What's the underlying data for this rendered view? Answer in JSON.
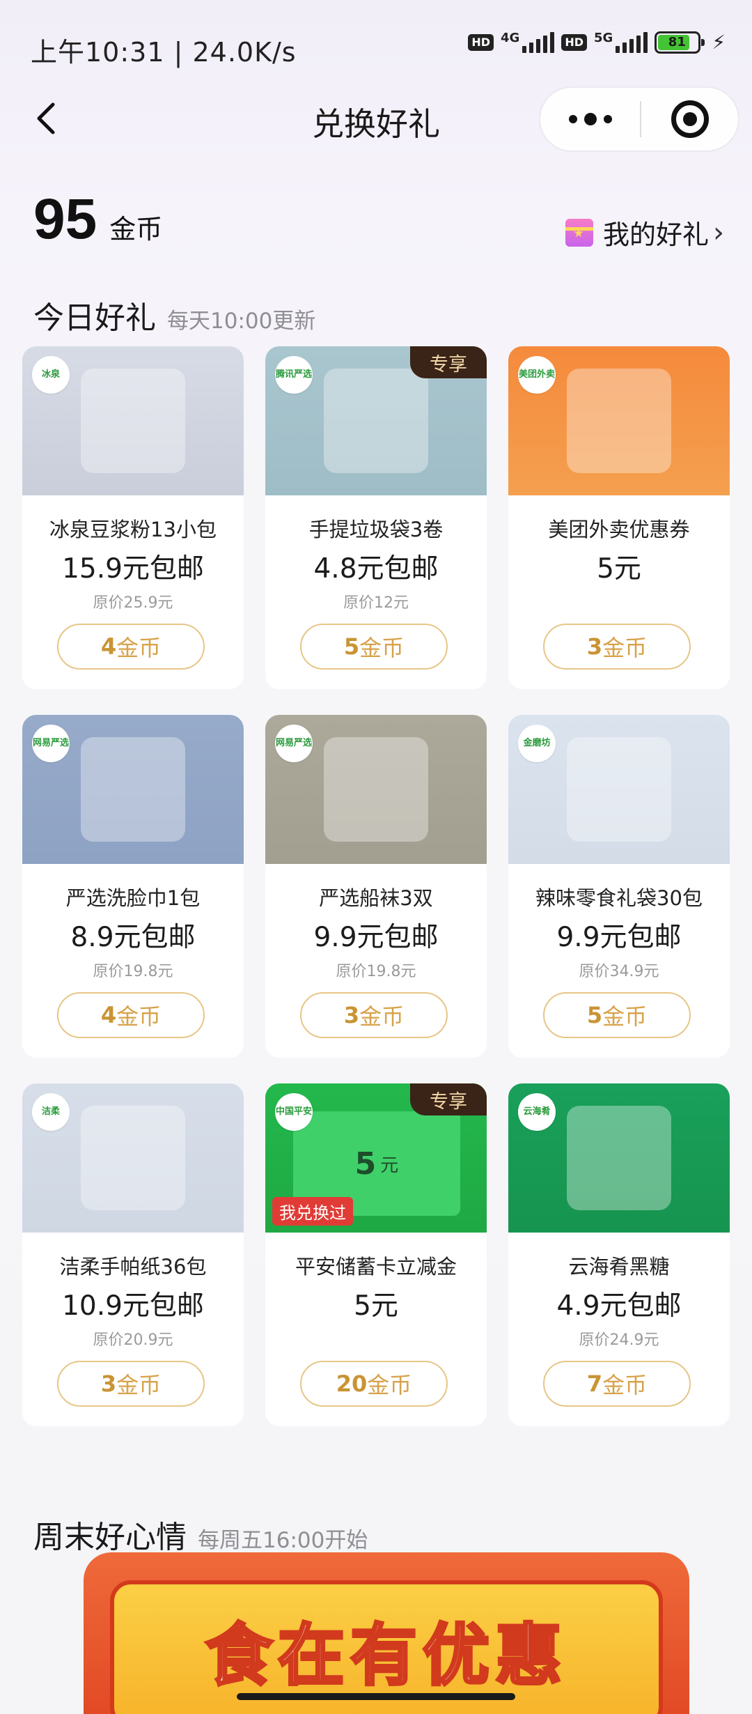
{
  "status_bar": {
    "time": "上午10:31 | 24.0K/s",
    "net1": "4G",
    "net2": "5G",
    "hd": "HD",
    "battery": "81"
  },
  "nav": {
    "title": "兑换好礼"
  },
  "coins": {
    "amount": "95",
    "unit": "金币"
  },
  "my_gifts_label": "我的好礼",
  "today": {
    "title": "今日好礼",
    "subtitle": "每天10:00更新"
  },
  "items": [
    {
      "name": "冰泉豆浆粉13小包",
      "price": "15.9元包邮",
      "original": "原价25.9元",
      "cost": "4",
      "cost_unit": "金币",
      "logo": "冰泉",
      "image_colors": [
        "#d7dbe6",
        "#c9ceda"
      ]
    },
    {
      "name": "手提垃圾袋3卷",
      "price": "4.8元包邮",
      "original": "原价12元",
      "cost": "5",
      "cost_unit": "金币",
      "logo": "腾讯严选",
      "badge": "专享",
      "image_colors": [
        "#a9c6cf",
        "#9fbdc6"
      ]
    },
    {
      "name": "美团外卖优惠券",
      "price": "5元",
      "original": "",
      "cost": "3",
      "cost_unit": "金币",
      "logo": "美团外卖",
      "image_colors": [
        "#f58a3c",
        "#f4a04f"
      ]
    },
    {
      "name": "严选洗脸巾1包",
      "price": "8.9元包邮",
      "original": "原价19.8元",
      "cost": "4",
      "cost_unit": "金币",
      "logo": "网易严选",
      "image_colors": [
        "#97aac9",
        "#8ea2c4"
      ]
    },
    {
      "name": "严选船袜3双",
      "price": "9.9元包邮",
      "original": "原价19.8元",
      "cost": "3",
      "cost_unit": "金币",
      "logo": "网易严选",
      "image_colors": [
        "#aca89a",
        "#a39f90"
      ]
    },
    {
      "name": "辣味零食礼袋30包",
      "price": "9.9元包邮",
      "original": "原价34.9元",
      "cost": "5",
      "cost_unit": "金币",
      "logo": "金磨坊",
      "image_colors": [
        "#dbe3ee",
        "#d4dce8"
      ]
    },
    {
      "name": "洁柔手帕纸36包",
      "price": "10.9元包邮",
      "original": "原价20.9元",
      "cost": "3",
      "cost_unit": "金币",
      "logo": "洁柔",
      "image_colors": [
        "#d7dee9",
        "#cfd7e3"
      ]
    },
    {
      "name": "平安储蓄卡立减金",
      "price": "5元",
      "original": "",
      "cost": "20",
      "cost_unit": "金币",
      "logo": "中国平安",
      "badge": "专享",
      "redeemed": "我兑换过",
      "card_amount": "5",
      "card_unit": "元",
      "image_colors": [
        "#23b84c",
        "#1fa844"
      ]
    },
    {
      "name": "云海肴黑糖",
      "price": "4.9元包邮",
      "original": "原价24.9元",
      "cost": "7",
      "cost_unit": "金币",
      "logo": "云海肴",
      "image_colors": [
        "#19a05a",
        "#16944f"
      ]
    }
  ],
  "weekend": {
    "title": "周末好心情",
    "subtitle": "每周五16:00开始"
  },
  "banner_text": "食在有优惠"
}
